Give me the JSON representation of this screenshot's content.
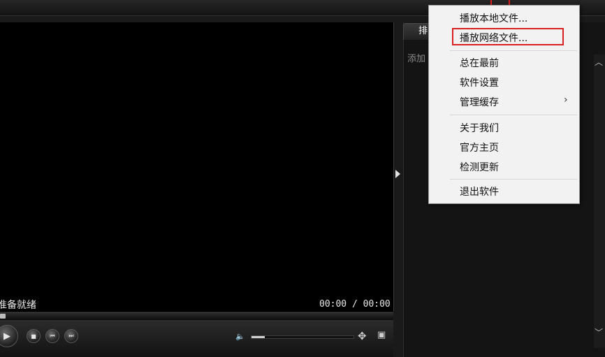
{
  "player": {
    "status_text": "准备就绪",
    "time_display": "00:00 / 00:00"
  },
  "controls": {
    "play_icon": "play-icon",
    "stop_icon": "stop-icon",
    "prev_icon": "previous-icon",
    "next_icon": "next-icon",
    "volume_icon": "volume-icon",
    "volume_level": 0.13,
    "move_icon": "move-icon",
    "screen_icon": "screen-icon"
  },
  "panel": {
    "tab_label": "排",
    "hint_text": "添加"
  },
  "menu": {
    "items": [
      {
        "label": "播放本地文件..."
      },
      {
        "label": "播放网络文件..."
      },
      {
        "label": "总在最前"
      },
      {
        "label": "软件设置"
      },
      {
        "label": "管理缓存",
        "submenu_arrow": "›"
      },
      {
        "label": "关于我们"
      },
      {
        "label": "官方主页"
      },
      {
        "label": "检测更新"
      },
      {
        "label": "退出软件"
      }
    ]
  },
  "colors": {
    "highlight": "#d92020",
    "background": "#000000",
    "menu_bg": "#f2f2f2"
  }
}
